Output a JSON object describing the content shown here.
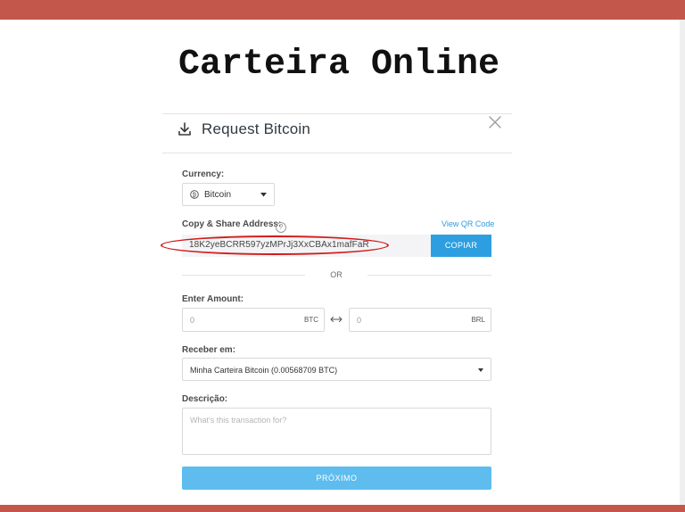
{
  "slide": {
    "title": "Carteira Online"
  },
  "modal": {
    "title": "Request Bitcoin",
    "icon": "download-icon",
    "close_icon": "close-icon"
  },
  "form": {
    "currency": {
      "label": "Currency:",
      "value": "Bitcoin",
      "icon": "bitcoin-coin-icon"
    },
    "address": {
      "label": "Copy & Share Address:",
      "help": "?",
      "qr_link": "View QR Code",
      "value": "18K2yeBCRR597yzMPrJj3XxCBAx1mafFaR",
      "copy_button": "COPIAR",
      "highlight_color": "#d11a1a"
    },
    "or_text": "OR",
    "amount": {
      "label": "Enter Amount:",
      "btc_value": "0",
      "btc_unit": "BTC",
      "brl_value": "0",
      "brl_unit": "BRL",
      "swap_icon": "swap-arrows-icon"
    },
    "receive": {
      "label": "Receber em:",
      "value": "Minha Carteira Bitcoin  (0.00568709 BTC)"
    },
    "description": {
      "label": "Descrição:",
      "placeholder": "What's this transaction for?"
    },
    "next_button": "PRÓXIMO"
  },
  "colors": {
    "accent": "#2d9fe0",
    "accent_light": "#5ebcee",
    "slide_band": "#c3574b"
  }
}
